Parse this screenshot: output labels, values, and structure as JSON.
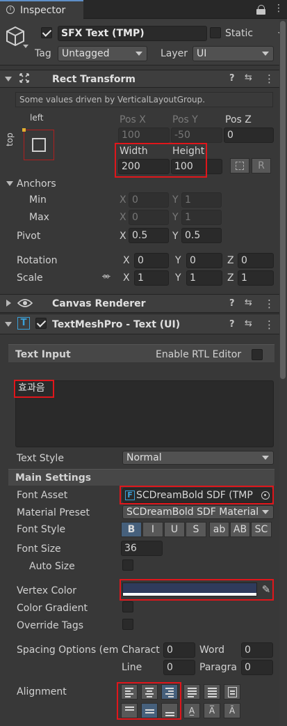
{
  "tab": {
    "title": "Inspector",
    "lock_icon": "lock-icon",
    "menu_icon": "kebab-menu-icon"
  },
  "object": {
    "name": "SFX Text (TMP)",
    "static_label": "Static",
    "tag_label": "Tag",
    "tag_value": "Untagged",
    "layer_label": "Layer",
    "layer_value": "UI"
  },
  "rect_transform": {
    "title": "Rect Transform",
    "driven_note": "Some values driven by VerticalLayoutGroup.",
    "anchor_h_label": "left",
    "anchor_v_label": "top",
    "pos_x_label": "Pos X",
    "pos_y_label": "Pos Y",
    "pos_z_label": "Pos Z",
    "pos_x": "100",
    "pos_y": "-50",
    "pos_z": "0",
    "width_label": "Width",
    "height_label": "Height",
    "width": "200",
    "height": "100",
    "r_button": "R",
    "anchors_label": "Anchors",
    "min_label": "Min",
    "max_label": "Max",
    "min_x": "0",
    "min_y": "1",
    "max_x": "0",
    "max_y": "1",
    "x_label": "X",
    "y_label": "Y",
    "z_label": "Z",
    "pivot_label": "Pivot",
    "pivot_x": "0.5",
    "pivot_y": "0.5",
    "rotation_label": "Rotation",
    "rot_x": "0",
    "rot_y": "0",
    "rot_z": "0",
    "scale_label": "Scale",
    "scale_x": "1",
    "scale_y": "1",
    "scale_z": "1"
  },
  "canvas_renderer": {
    "title": "Canvas Renderer"
  },
  "tmp": {
    "title": "TextMeshPro - Text (UI)",
    "text_input_label": "Text Input",
    "rtl_label": "Enable RTL Editor",
    "text_value": "효과음",
    "text_style_label": "Text Style",
    "text_style_value": "Normal",
    "main_settings_label": "Main Settings",
    "font_asset_label": "Font Asset",
    "font_asset_value": "SCDreamBold SDF (TMP",
    "material_preset_label": "Material Preset",
    "material_preset_value": "SCDreamBold SDF Material",
    "font_style_label": "Font Style",
    "font_style_buttons": [
      "B",
      "I",
      "U",
      "S",
      "ab",
      "AB",
      "SC"
    ],
    "font_size_label": "Font Size",
    "font_size_value": "36",
    "auto_size_label": "Auto Size",
    "vertex_color_label": "Vertex Color",
    "vertex_color": "#2f3b5c",
    "color_gradient_label": "Color Gradient",
    "override_tags_label": "Override Tags",
    "spacing_label": "Spacing Options (em",
    "character_label": "Charact",
    "character_value": "0",
    "word_label": "Word",
    "word_value": "0",
    "line_label": "Line",
    "line_value": "0",
    "paragraph_label": "Paragra",
    "paragraph_value": "0",
    "alignment_label": "Alignment"
  },
  "colors": {
    "highlight": "#e0161b",
    "selected": "#46607c"
  }
}
